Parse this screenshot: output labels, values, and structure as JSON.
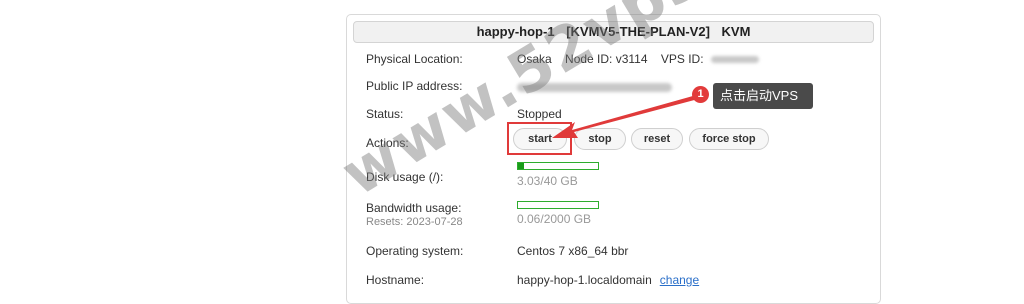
{
  "vps": {
    "title_name": "happy-hop-1",
    "title_plan": "[KVMV5-THE-PLAN-V2]",
    "title_type": "KVM"
  },
  "details": {
    "physical_location_label": "Physical Location:",
    "location": "Osaka",
    "node_id_label": "Node ID: v3114",
    "vps_id_label": "VPS ID:",
    "public_ip_label": "Public IP address:",
    "status_label": "Status:",
    "status_value": "Stopped",
    "actions_label": "Actions:",
    "disk_label": "Disk usage (/):",
    "disk_text": "3.03/40 GB",
    "disk_fraction": 0.076,
    "bandwidth_label": "Bandwidth usage:",
    "bandwidth_resets": "Resets: 2023-07-28",
    "bandwidth_text": "0.06/2000 GB",
    "bandwidth_fraction": 0.0,
    "os_label": "Operating system:",
    "os_value": "Centos 7 x86_64 bbr",
    "hostname_label": "Hostname:",
    "hostname_value": "happy-hop-1.localdomain",
    "change_link": "change"
  },
  "actions": {
    "start": "start",
    "stop": "stop",
    "reset": "reset",
    "force_stop": "force stop"
  },
  "annotation": {
    "step_number": "1",
    "tip_text": "点击启动VPS",
    "color": "#e03a3a"
  },
  "watermark": {
    "text": "www.52vps.com"
  },
  "colors": {
    "bar_border": "#2eac2e",
    "bar_fill": "#1a9c1a",
    "tooltip_bg": "#4a4a4a"
  }
}
